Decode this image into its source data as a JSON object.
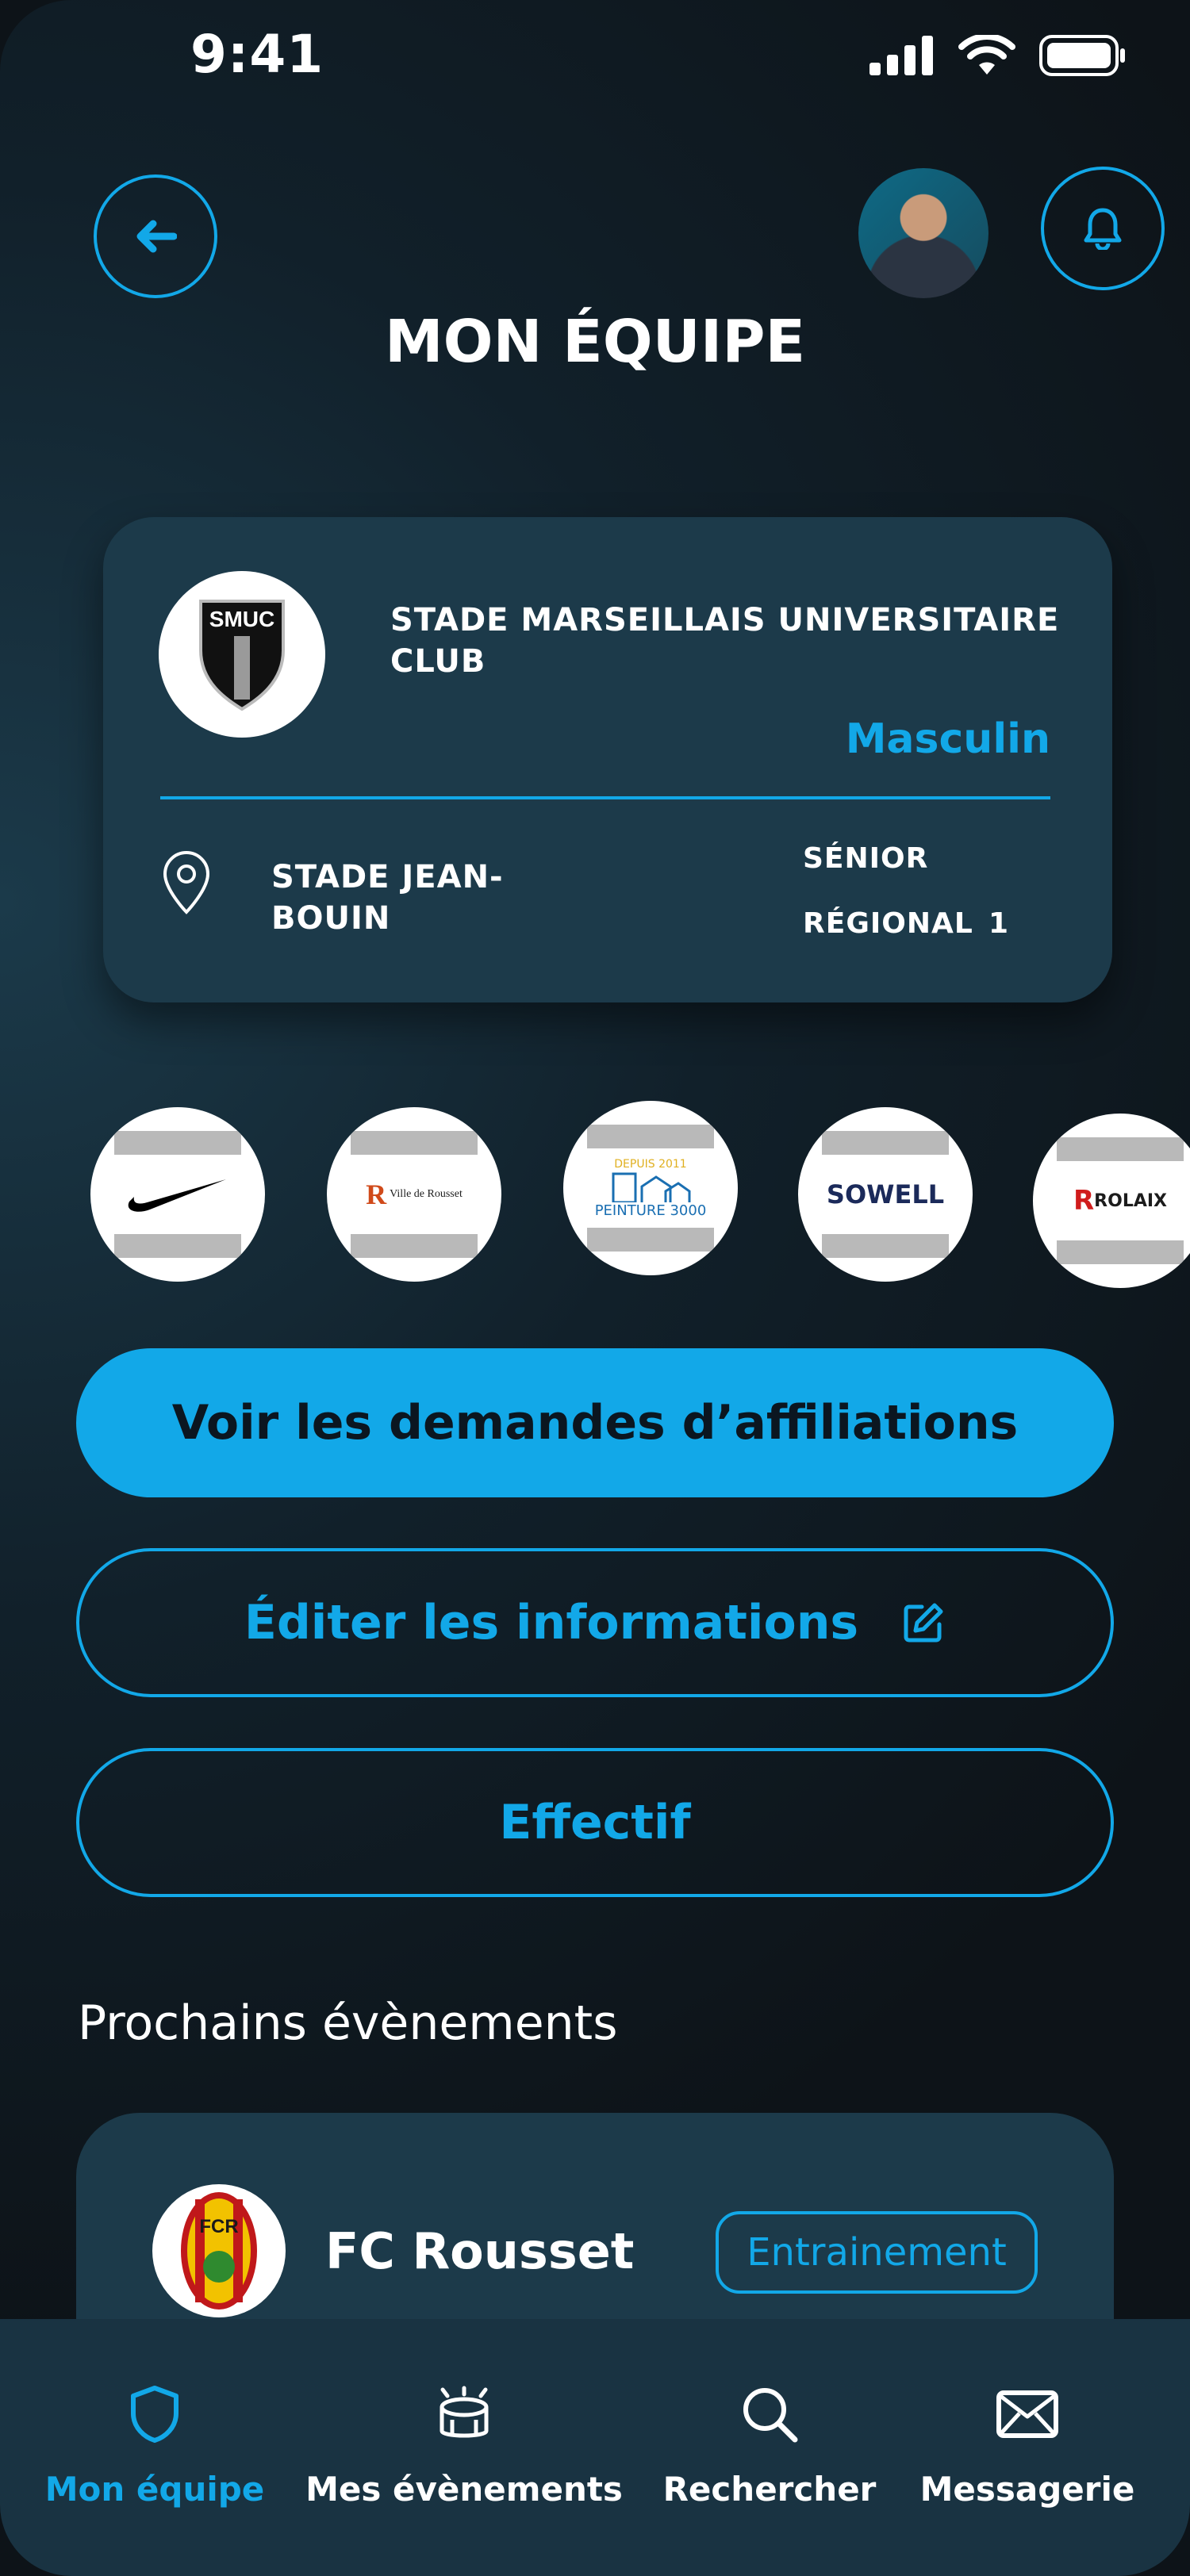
{
  "status_bar": {
    "time": "9:41"
  },
  "header": {
    "title": "MON ÉQUIPE"
  },
  "team": {
    "crest_text": "SMUC",
    "name": "STADE MARSEILLAIS UNIVERSITAIRE CLUB",
    "gender": "Masculin",
    "stadium": "STADE JEAN-BOUIN",
    "category": "SÉNIOR",
    "level": "RÉGIONAL",
    "level_number": "1"
  },
  "sponsors": [
    {
      "name": "Nike",
      "icon": "nike-swoosh-icon"
    },
    {
      "name": "Ville de Rousset"
    },
    {
      "name": "PEINTURE 3000",
      "tagline": "DEPUIS 2011"
    },
    {
      "name": "SOWELL"
    },
    {
      "name": "ROLAIX"
    }
  ],
  "actions": {
    "affiliations_label": "Voir les demandes d’affiliations",
    "edit_label": "Éditer les informations",
    "effectif_label": "Effectif"
  },
  "events": {
    "section_title": "Prochains évènements",
    "items": [
      {
        "team": "FC Rousset",
        "logo_text": "FCR",
        "type": "Entrainement"
      }
    ]
  },
  "tabbar": {
    "items": [
      {
        "label": "Mon équipe",
        "icon": "shield-icon",
        "active": true
      },
      {
        "label": "Mes évènements",
        "icon": "stadium-icon",
        "active": false
      },
      {
        "label": "Rechercher",
        "icon": "search-icon",
        "active": false
      },
      {
        "label": "Messagerie",
        "icon": "mail-icon",
        "active": false
      }
    ]
  },
  "colors": {
    "accent": "#12a8e8",
    "card": "#1c3a4a",
    "background": "#0d1318"
  }
}
